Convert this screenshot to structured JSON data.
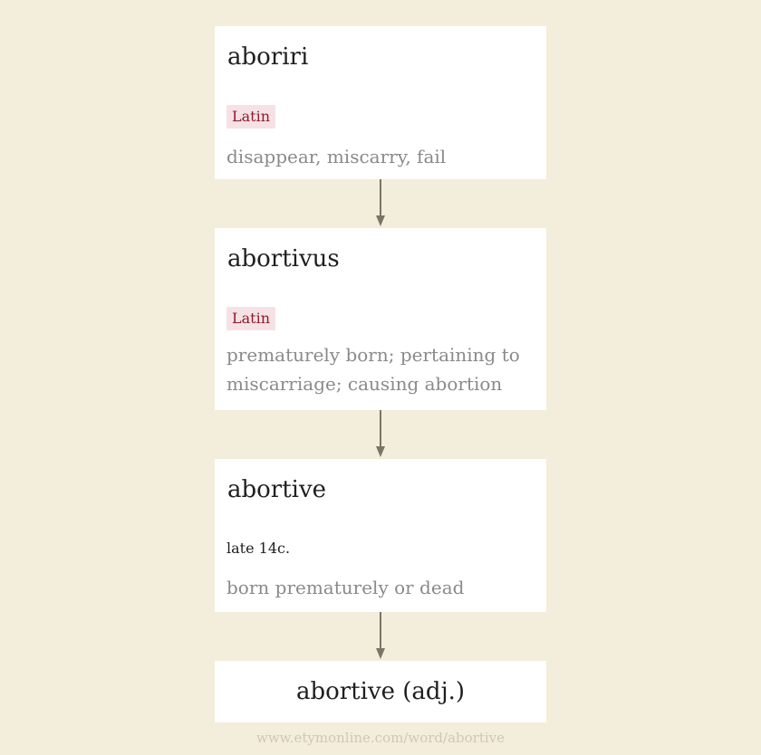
{
  "nodes": [
    {
      "word": "aboriri",
      "language": "Latin",
      "gloss": "disappear, miscarry, fail"
    },
    {
      "word": "abortivus",
      "language": "Latin",
      "gloss": "prematurely born; pertaining to miscarriage; causing abortion"
    },
    {
      "word": "abortive",
      "date": "late 14c.",
      "gloss": "born prematurely or dead"
    }
  ],
  "final": {
    "word": "abortive (adj.)"
  },
  "source": {
    "url": "www.etymonline.com/word/abortive"
  },
  "colors": {
    "background": "#f3eddb",
    "card": "#ffffff",
    "language_tag_bg": "#f6e2e4",
    "language_tag_text": "#8d1b2b",
    "gloss_text": "#8a8a8a",
    "arrow": "#7a7566"
  }
}
